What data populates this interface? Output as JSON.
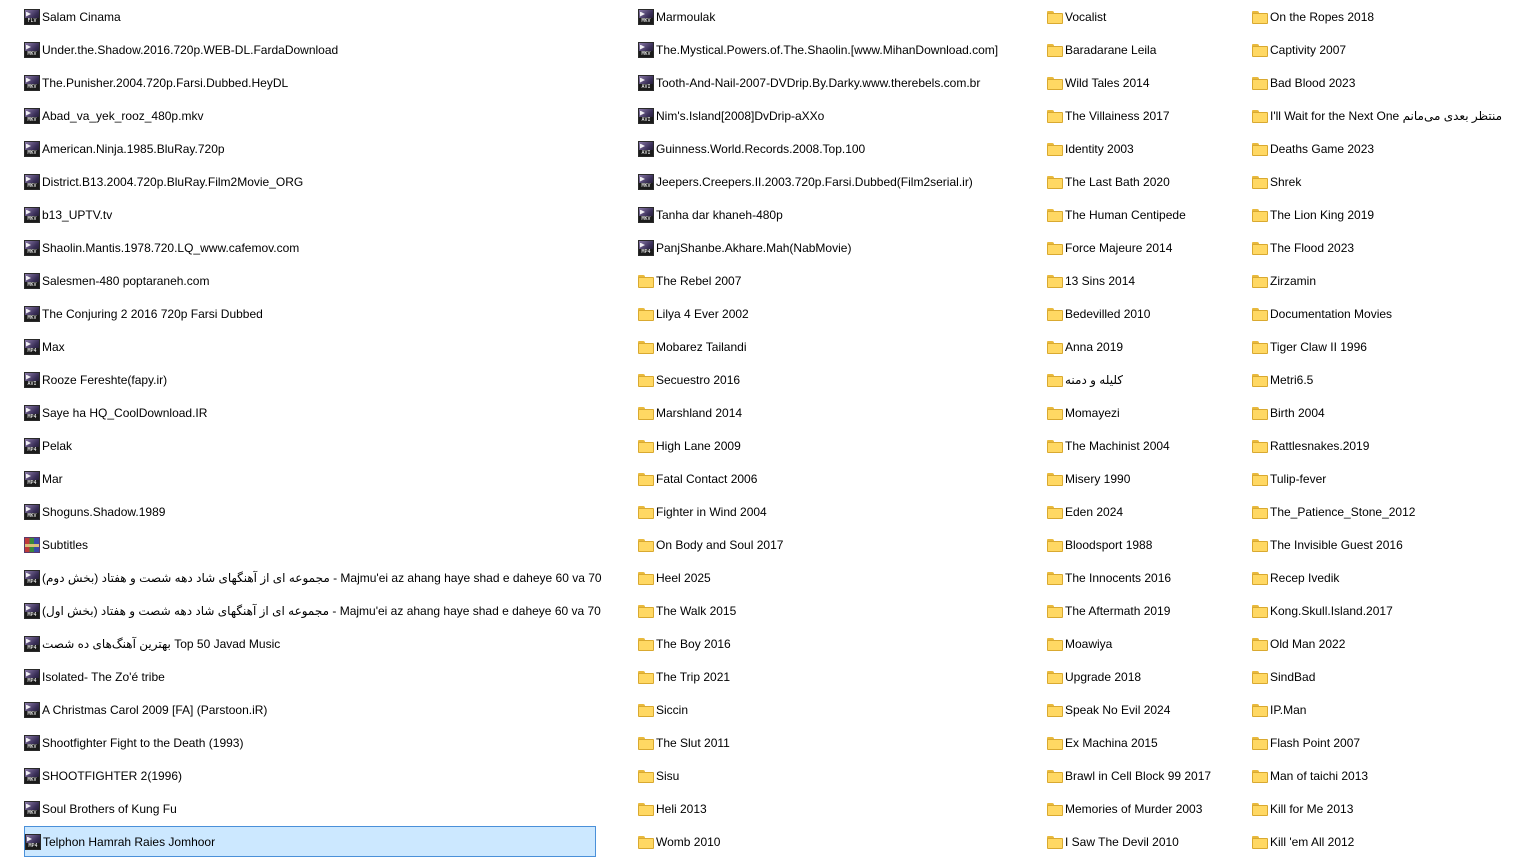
{
  "columns": [
    {
      "items": [
        {
          "label": "Salam Cinama",
          "icon": "flv-video-file-icon",
          "ext": "FLV",
          "type": "file"
        },
        {
          "label": "Under.the.Shadow.2016.720p.WEB-DL.FardaDownload",
          "icon": "mkv-video-file-icon",
          "ext": "MKV",
          "type": "file"
        },
        {
          "label": "The.Punisher.2004.720p.Farsi.Dubbed.HeyDL",
          "icon": "mkv-video-file-icon",
          "ext": "MKV",
          "type": "file"
        },
        {
          "label": "Abad_va_yek_rooz_480p.mkv",
          "icon": "mkv-video-file-icon",
          "ext": "MKV",
          "type": "file"
        },
        {
          "label": "American.Ninja.1985.BluRay.720p",
          "icon": "mkv-video-file-icon",
          "ext": "MKV",
          "type": "file"
        },
        {
          "label": "District.B13.2004.720p.BluRay.Film2Movie_ORG",
          "icon": "mkv-video-file-icon",
          "ext": "MKV",
          "type": "file"
        },
        {
          "label": "b13_UPTV.tv",
          "icon": "mkv-video-file-icon",
          "ext": "MKV",
          "type": "file"
        },
        {
          "label": "Shaolin.Mantis.1978.720.LQ_www.cafemov.com",
          "icon": "mkv-video-file-icon",
          "ext": "MKV",
          "type": "file"
        },
        {
          "label": "Salesmen-480 poptaraneh.com",
          "icon": "mkv-video-file-icon",
          "ext": "MKV",
          "type": "file"
        },
        {
          "label": "The Conjuring 2 2016 720p Farsi Dubbed",
          "icon": "mkv-video-file-icon",
          "ext": "MKV",
          "type": "file"
        },
        {
          "label": "Max",
          "icon": "mp4-video-file-icon",
          "ext": "MP4",
          "type": "file"
        },
        {
          "label": "Rooze Fereshte(fapy.ir)",
          "icon": "avi-video-file-icon",
          "ext": "AVI",
          "type": "file"
        },
        {
          "label": "Saye ha HQ_CoolDownload.IR",
          "icon": "mp4-video-file-icon",
          "ext": "MP4",
          "type": "file"
        },
        {
          "label": "Pelak",
          "icon": "mp4-video-file-icon",
          "ext": "MP4",
          "type": "file"
        },
        {
          "label": "Mar",
          "icon": "mp4-video-file-icon",
          "ext": "MP4",
          "type": "file"
        },
        {
          "label": "Shoguns.Shadow.1989",
          "icon": "mkv-video-file-icon",
          "ext": "MKV",
          "type": "file"
        },
        {
          "label": "Subtitles",
          "icon": "archive-file-icon",
          "ext": "",
          "type": "archive"
        },
        {
          "label": "مجموعه ای از آهنگهای شاد دهه شصت و هفتاد (بخش دوم) - Majmu'ei az ahang haye shad e daheye 60 va 70",
          "icon": "mp4-video-file-icon",
          "ext": "MP4",
          "type": "file"
        },
        {
          "label": "مجموعه ای از آهنگهای شاد دهه شصت و هفتاد (بخش اول) - Majmu'ei az ahang haye shad e daheye 60 va 70",
          "icon": "mp4-video-file-icon",
          "ext": "MP4",
          "type": "file"
        },
        {
          "label": "بهترین آهنگ‌های ده شصت Top 50 Javad Music",
          "icon": "mp4-video-file-icon",
          "ext": "MP4",
          "type": "file"
        },
        {
          "label": "Isolated- The Zo'é tribe",
          "icon": "mp4-video-file-icon",
          "ext": "MP4",
          "type": "file"
        },
        {
          "label": "A Christmas Carol 2009 [FA] (Parstoon.iR)",
          "icon": "mkv-video-file-icon",
          "ext": "MKV",
          "type": "file"
        },
        {
          "label": "Shootfighter Fight to the Death (1993)",
          "icon": "mkv-video-file-icon",
          "ext": "MKV",
          "type": "file"
        },
        {
          "label": "SHOOTFIGHTER 2(1996)",
          "icon": "mkv-video-file-icon",
          "ext": "MKV",
          "type": "file"
        },
        {
          "label": "Soul Brothers of Kung Fu",
          "icon": "mkv-video-file-icon",
          "ext": "MKV",
          "type": "file"
        },
        {
          "label": "Telphon Hamrah Raies Jomhoor",
          "icon": "mp4-video-file-icon",
          "ext": "MP4",
          "type": "file",
          "selected": true
        }
      ]
    },
    {
      "items": [
        {
          "label": "Marmoulak",
          "icon": "mkv-video-file-icon",
          "ext": "MKV",
          "type": "file"
        },
        {
          "label": "The.Mystical.Powers.of.The.Shaolin.[www.MihanDownload.com]",
          "icon": "mkv-video-file-icon",
          "ext": "MKV",
          "type": "file"
        },
        {
          "label": "Tooth-And-Nail-2007-DVDrip.By.Darky.www.therebels.com.br",
          "icon": "avi-video-file-icon",
          "ext": "AVI",
          "type": "file"
        },
        {
          "label": "Nim's.Island[2008]DvDrip-aXXo",
          "icon": "avi-video-file-icon",
          "ext": "AVI",
          "type": "file"
        },
        {
          "label": "Guinness.World.Records.2008.Top.100",
          "icon": "avi-video-file-icon",
          "ext": "AVI",
          "type": "file"
        },
        {
          "label": "Jeepers.Creepers.II.2003.720p.Farsi.Dubbed(Film2serial.ir)",
          "icon": "mkv-video-file-icon",
          "ext": "MKV",
          "type": "file"
        },
        {
          "label": "Tanha dar khaneh-480p",
          "icon": "mkv-video-file-icon",
          "ext": "MKV",
          "type": "file"
        },
        {
          "label": "PanjShanbe.Akhare.Mah(NabMovie)",
          "icon": "mp4-video-file-icon",
          "ext": "MP4",
          "type": "file"
        },
        {
          "label": "The Rebel 2007",
          "icon": "folder-icon",
          "type": "folder"
        },
        {
          "label": "Lilya 4 Ever 2002",
          "icon": "folder-icon",
          "type": "folder"
        },
        {
          "label": "Mobarez Tailandi",
          "icon": "folder-icon",
          "type": "folder"
        },
        {
          "label": "Secuestro 2016",
          "icon": "folder-icon",
          "type": "folder"
        },
        {
          "label": "Marshland 2014",
          "icon": "folder-icon",
          "type": "folder"
        },
        {
          "label": "High Lane 2009",
          "icon": "folder-icon",
          "type": "folder"
        },
        {
          "label": "Fatal Contact 2006",
          "icon": "folder-icon",
          "type": "folder"
        },
        {
          "label": "Fighter in Wind 2004",
          "icon": "folder-icon",
          "type": "folder"
        },
        {
          "label": "On Body and Soul 2017",
          "icon": "folder-icon",
          "type": "folder"
        },
        {
          "label": "Heel 2025",
          "icon": "folder-icon",
          "type": "folder"
        },
        {
          "label": "The Walk 2015",
          "icon": "folder-icon",
          "type": "folder"
        },
        {
          "label": "The Boy 2016",
          "icon": "folder-icon",
          "type": "folder"
        },
        {
          "label": "The Trip 2021",
          "icon": "folder-icon",
          "type": "folder"
        },
        {
          "label": "Siccin",
          "icon": "folder-icon",
          "type": "folder"
        },
        {
          "label": "The Slut 2011",
          "icon": "folder-icon",
          "type": "folder"
        },
        {
          "label": "Sisu",
          "icon": "folder-icon",
          "type": "folder"
        },
        {
          "label": "Heli 2013",
          "icon": "folder-icon",
          "type": "folder"
        },
        {
          "label": "Womb 2010",
          "icon": "folder-icon",
          "type": "folder"
        }
      ]
    },
    {
      "items": [
        {
          "label": "Vocalist",
          "icon": "folder-icon",
          "type": "folder"
        },
        {
          "label": "Baradarane Leila",
          "icon": "folder-icon",
          "type": "folder"
        },
        {
          "label": "Wild Tales 2014",
          "icon": "folder-icon",
          "type": "folder"
        },
        {
          "label": "The Villainess 2017",
          "icon": "folder-icon",
          "type": "folder"
        },
        {
          "label": "Identity 2003",
          "icon": "folder-icon",
          "type": "folder"
        },
        {
          "label": "The Last Bath 2020",
          "icon": "folder-icon",
          "type": "folder"
        },
        {
          "label": "The Human Centipede",
          "icon": "folder-icon",
          "type": "folder"
        },
        {
          "label": "Force Majeure 2014",
          "icon": "folder-icon",
          "type": "folder"
        },
        {
          "label": "13 Sins 2014",
          "icon": "folder-icon",
          "type": "folder"
        },
        {
          "label": "Bedevilled 2010",
          "icon": "folder-icon",
          "type": "folder"
        },
        {
          "label": "Anna 2019",
          "icon": "folder-icon",
          "type": "folder"
        },
        {
          "label": "کلیله و دمنه",
          "icon": "folder-icon",
          "type": "folder"
        },
        {
          "label": "Momayezi",
          "icon": "folder-icon",
          "type": "folder"
        },
        {
          "label": "The Machinist 2004",
          "icon": "folder-icon",
          "type": "folder"
        },
        {
          "label": "Misery 1990",
          "icon": "folder-icon",
          "type": "folder"
        },
        {
          "label": "Eden 2024",
          "icon": "folder-icon",
          "type": "folder"
        },
        {
          "label": "Bloodsport 1988",
          "icon": "folder-icon",
          "type": "folder"
        },
        {
          "label": "The Innocents 2016",
          "icon": "folder-icon",
          "type": "folder"
        },
        {
          "label": "The Aftermath 2019",
          "icon": "folder-icon",
          "type": "folder"
        },
        {
          "label": "Moawiya",
          "icon": "folder-icon",
          "type": "folder"
        },
        {
          "label": "Upgrade 2018",
          "icon": "folder-icon",
          "type": "folder"
        },
        {
          "label": "Speak No Evil 2024",
          "icon": "folder-icon",
          "type": "folder"
        },
        {
          "label": "Ex Machina 2015",
          "icon": "folder-icon",
          "type": "folder"
        },
        {
          "label": "Brawl in Cell Block 99 2017",
          "icon": "folder-icon",
          "type": "folder"
        },
        {
          "label": "Memories of Murder 2003",
          "icon": "folder-icon",
          "type": "folder"
        },
        {
          "label": "I Saw The Devil 2010",
          "icon": "folder-icon",
          "type": "folder"
        }
      ]
    },
    {
      "items": [
        {
          "label": "On the Ropes 2018",
          "icon": "folder-icon",
          "type": "folder"
        },
        {
          "label": "Captivity 2007",
          "icon": "folder-icon",
          "type": "folder"
        },
        {
          "label": "Bad Blood 2023",
          "icon": "folder-icon",
          "type": "folder"
        },
        {
          "label": "I'll Wait for the Next One منتظر بعدی می‌مانم",
          "icon": "folder-icon",
          "type": "folder"
        },
        {
          "label": "Deaths Game 2023",
          "icon": "folder-icon",
          "type": "folder"
        },
        {
          "label": "Shrek",
          "icon": "folder-icon",
          "type": "folder"
        },
        {
          "label": "The Lion King 2019",
          "icon": "folder-icon",
          "type": "folder"
        },
        {
          "label": "The Flood 2023",
          "icon": "folder-icon",
          "type": "folder"
        },
        {
          "label": "Zirzamin",
          "icon": "folder-icon",
          "type": "folder"
        },
        {
          "label": "Documentation Movies",
          "icon": "folder-icon",
          "type": "folder"
        },
        {
          "label": "Tiger Claw II 1996",
          "icon": "folder-icon",
          "type": "folder"
        },
        {
          "label": "Metri6.5",
          "icon": "folder-icon",
          "type": "folder"
        },
        {
          "label": "Birth 2004",
          "icon": "folder-icon",
          "type": "folder"
        },
        {
          "label": "Rattlesnakes.2019",
          "icon": "folder-icon",
          "type": "folder"
        },
        {
          "label": "Tulip-fever",
          "icon": "folder-icon",
          "type": "folder"
        },
        {
          "label": "The_Patience_Stone_2012",
          "icon": "folder-icon",
          "type": "folder"
        },
        {
          "label": "The Invisible Guest 2016",
          "icon": "folder-icon",
          "type": "folder"
        },
        {
          "label": "Recep Ivedik",
          "icon": "folder-icon",
          "type": "folder"
        },
        {
          "label": "Kong.Skull.Island.2017",
          "icon": "folder-icon",
          "type": "folder"
        },
        {
          "label": "Old Man 2022",
          "icon": "folder-icon",
          "type": "folder"
        },
        {
          "label": "SindBad",
          "icon": "folder-icon",
          "type": "folder"
        },
        {
          "label": "IP.Man",
          "icon": "folder-icon",
          "type": "folder"
        },
        {
          "label": "Flash Point 2007",
          "icon": "folder-icon",
          "type": "folder"
        },
        {
          "label": "Man of taichi 2013",
          "icon": "folder-icon",
          "type": "folder"
        },
        {
          "label": "Kill for Me 2013",
          "icon": "folder-icon",
          "type": "folder"
        },
        {
          "label": "Kill 'em All 2012",
          "icon": "folder-icon",
          "type": "folder"
        }
      ]
    }
  ]
}
